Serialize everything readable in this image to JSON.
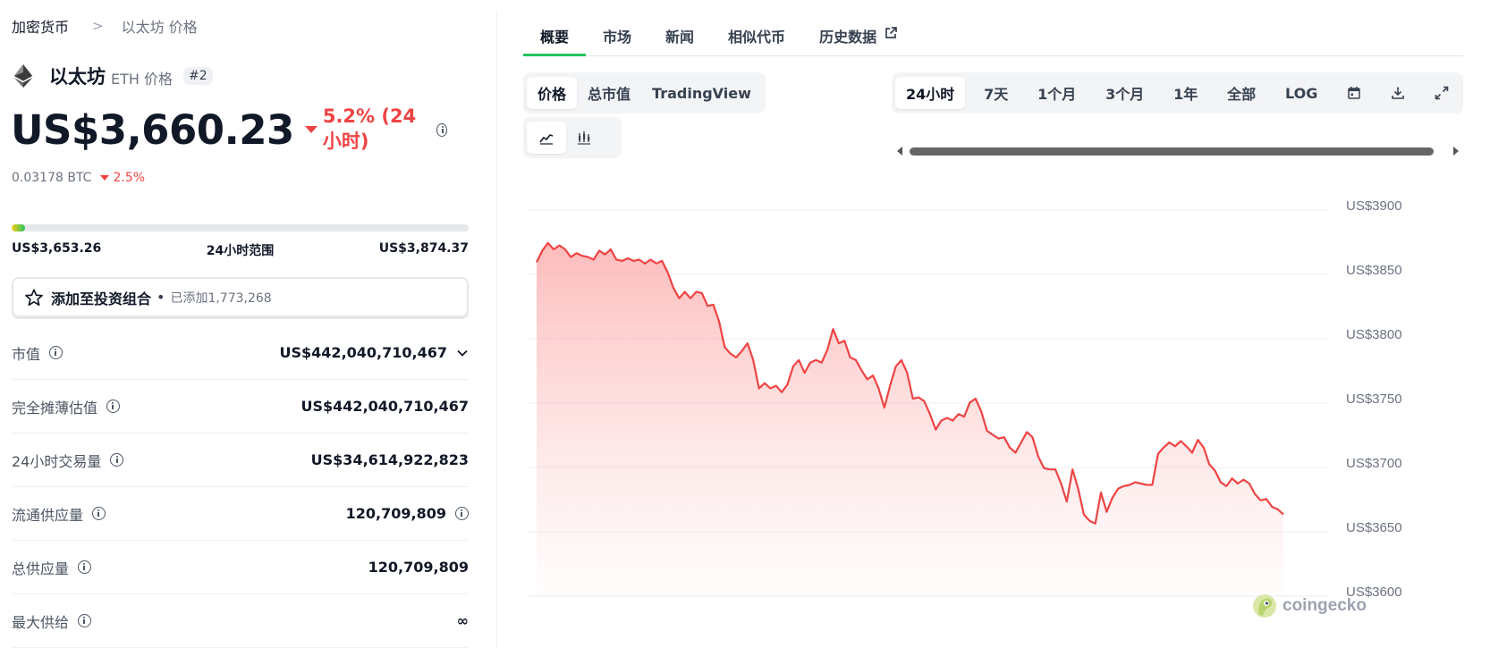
{
  "breadcrumb": {
    "root": "加密货币",
    "current": "以太坊 价格"
  },
  "coin": {
    "name": "以太坊",
    "symbol_label": "ETH 价格",
    "rank": "#2",
    "logo_icon": "ethereum-icon"
  },
  "price": {
    "value": "US$3,660.23",
    "change": "5.2% (24小时)",
    "btc_value": "0.03178 BTC",
    "btc_change": "2.5%",
    "change_color": "#ef4444"
  },
  "range": {
    "low": "US$3,653.26",
    "label": "24小时范围",
    "high": "US$3,874.37",
    "position_fraction": 0.03
  },
  "portfolio": {
    "label": "添加至投资组合",
    "dot": "•",
    "added": "已添加1,773,268"
  },
  "stats": [
    {
      "key": "市值",
      "value": "US$442,040,710,467"
    },
    {
      "key": "完全摊薄估值",
      "value": "US$442,040,710,467"
    },
    {
      "key": "24小时交易量",
      "value": "US$34,614,922,823"
    },
    {
      "key": "流通供应量",
      "value": "120,709,809"
    },
    {
      "key": "总供应量",
      "value": "120,709,809"
    },
    {
      "key": "最大供给",
      "value": "∞"
    }
  ],
  "tabs": [
    "概要",
    "市场",
    "新闻",
    "相似代币",
    "历史数据"
  ],
  "chart_modes": [
    "价格",
    "总市值",
    "TradingView"
  ],
  "time_ranges": [
    "24小时",
    "7天",
    "1个月",
    "3个月",
    "1年",
    "全部",
    "LOG"
  ],
  "toolbar_icons": [
    "calendar-icon",
    "download-icon",
    "expand-icon"
  ],
  "chart_type_icons": [
    "line-chart-icon",
    "candlestick-icon"
  ],
  "watermark": "coingecko",
  "chart_data": {
    "type": "area",
    "ytick_labels": [
      "US$3900",
      "US$3850",
      "US$3800",
      "US$3750",
      "US$3700",
      "US$3650",
      "US$3600"
    ],
    "yticks": [
      3900,
      3850,
      3800,
      3750,
      3700,
      3650,
      3600
    ],
    "ylim": [
      3600,
      3900
    ],
    "line_color": "#ef4444",
    "grid": true,
    "values": [
      3856,
      3865,
      3871,
      3866,
      3869,
      3866,
      3860,
      3863,
      3861,
      3860,
      3858,
      3865,
      3862,
      3866,
      3858,
      3857,
      3859,
      3857,
      3858,
      3855,
      3858,
      3855,
      3857,
      3848,
      3836,
      3828,
      3833,
      3828,
      3833,
      3832,
      3822,
      3823,
      3810,
      3790,
      3785,
      3782,
      3787,
      3793,
      3780,
      3758,
      3762,
      3758,
      3760,
      3755,
      3761,
      3775,
      3780,
      3770,
      3778,
      3780,
      3778,
      3788,
      3804,
      3793,
      3795,
      3782,
      3780,
      3772,
      3765,
      3768,
      3758,
      3743,
      3760,
      3775,
      3780,
      3770,
      3750,
      3751,
      3748,
      3738,
      3726,
      3733,
      3735,
      3733,
      3738,
      3736,
      3747,
      3750,
      3740,
      3725,
      3722,
      3719,
      3720,
      3712,
      3708,
      3716,
      3724,
      3720,
      3705,
      3696,
      3695,
      3695,
      3684,
      3670,
      3695,
      3680,
      3660,
      3655,
      3653,
      3677,
      3662,
      3673,
      3680,
      3682,
      3683,
      3685,
      3684,
      3683,
      3683,
      3707,
      3712,
      3716,
      3713,
      3717,
      3713,
      3708,
      3718,
      3712,
      3699,
      3694,
      3685,
      3682,
      3688,
      3684,
      3687,
      3684,
      3676,
      3671,
      3672,
      3666,
      3664,
      3660
    ]
  }
}
